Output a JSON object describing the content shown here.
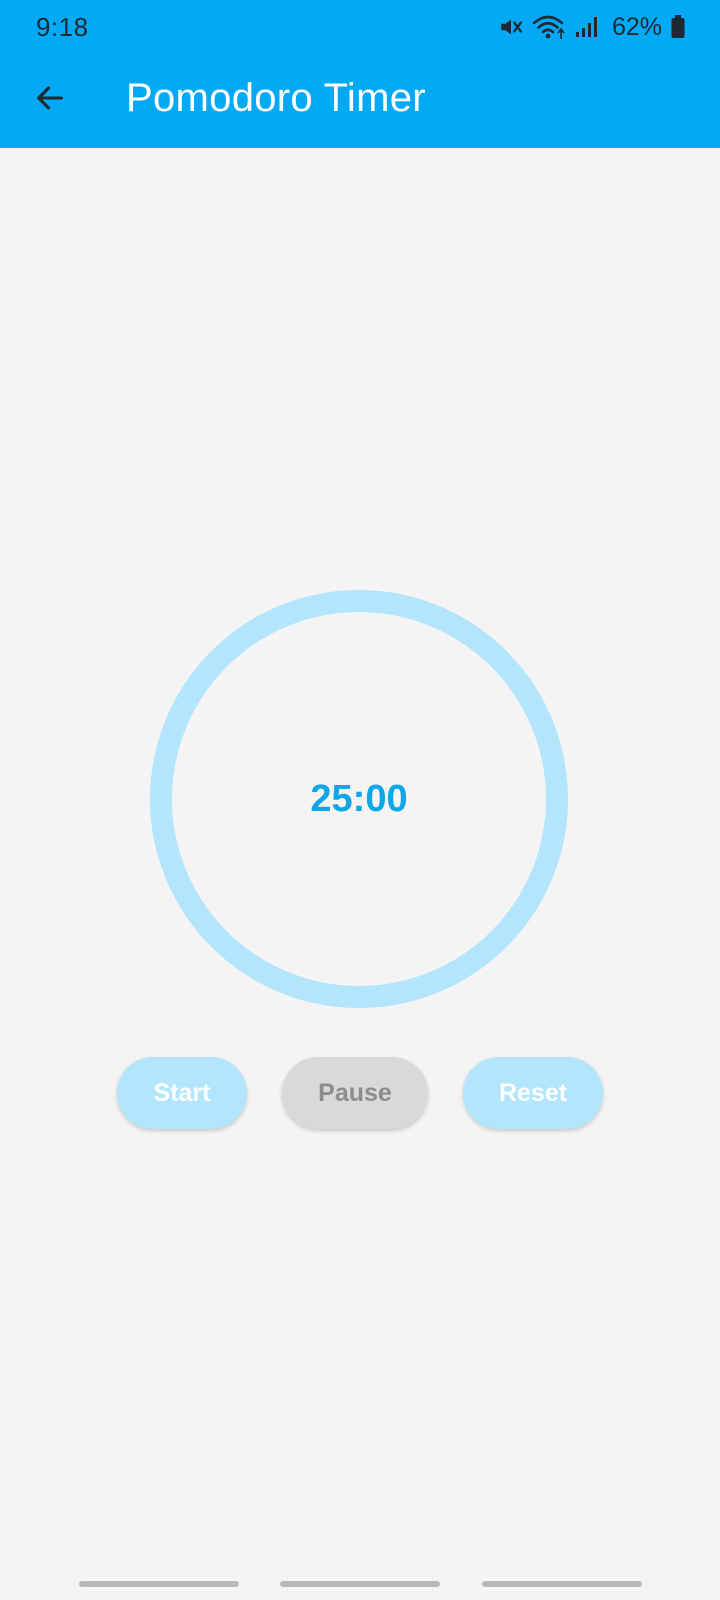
{
  "status_bar": {
    "time": "9:18",
    "battery": "62%",
    "icons": [
      "mute-icon",
      "wifi-icon",
      "signal-icon",
      "battery-icon"
    ]
  },
  "app_bar": {
    "title": "Pomodoro Timer",
    "back_icon": "arrow-left-icon"
  },
  "timer": {
    "display": "25:00"
  },
  "controls": {
    "start_label": "Start",
    "pause_label": "Pause",
    "reset_label": "Reset"
  },
  "colors": {
    "primary": "#03a9f4",
    "ring": "#b3e5fc",
    "timer_text": "#0ea5e9",
    "background": "#f4f4f4",
    "disabled": "#d9d9d9"
  }
}
